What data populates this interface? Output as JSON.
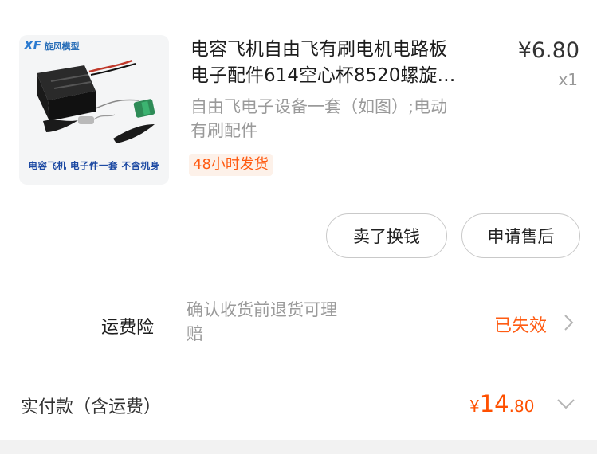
{
  "product": {
    "image_brand": "旋风模型",
    "image_brand_letters": "XF",
    "image_caption": "电容飞机 电子件一套 不含机身",
    "title_line1": "电容飞机自由飞有刷电机电路板",
    "title_line2": "电子配件614空心杯8520螺旋…",
    "price": "¥6.80",
    "quantity": "x1",
    "sku_line1": "自由飞电子设备一套（如图）;电动",
    "sku_line2": "有刷配件",
    "shipping_tag": "48小时发货"
  },
  "actions": {
    "sell_label": "卖了换钱",
    "after_sale_label": "申请售后"
  },
  "insurance": {
    "label": "运费险",
    "desc_line1": "确认收货前退货可理",
    "desc_line2": "赔",
    "status": "已失效",
    "status_color": "#ff5b12"
  },
  "payment": {
    "label": "实付款（含运费）",
    "currency": "¥",
    "amount_int": "14",
    "amount_dec": ".80",
    "amount_color": "#ff5000"
  },
  "icons": {
    "chevron_right": "chevron-right-icon",
    "chevron_down": "chevron-down-icon"
  }
}
